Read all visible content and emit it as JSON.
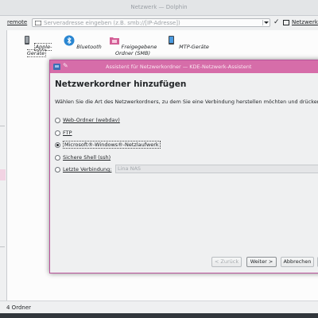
{
  "main_window": {
    "title": "Netzwerk — Dolphin",
    "toolbar": {
      "remote_label": "remote",
      "location_placeholder": "Serveradresse eingeben (z.B. smb://[IP-Adresse])",
      "confirm_glyph": "✓",
      "breadcrumb": "Netzwerk"
    },
    "places": [
      {
        "label": "Apple-Geräte",
        "icon": "apple-device-icon"
      },
      {
        "label": "Bluetooth",
        "icon": "bluetooth-icon"
      },
      {
        "label": "Freigegebene Ordner (SMB)",
        "icon": "smb-folder-icon"
      },
      {
        "label": "MTP-Geräte",
        "icon": "mtp-device-icon"
      }
    ],
    "status_text": "4 Ordner"
  },
  "wizard": {
    "title": "Assistent für Netzwerkordner — KDE-Netzwerk-Assistent",
    "heading": "Netzwerkordner hinzufügen",
    "description": "Wählen Sie die Art des Netzwerkordners, zu dem Sie eine Verbindung herstellen möchten und drücken",
    "options": [
      {
        "label": "Web-Ordner (webdav)",
        "checked": false
      },
      {
        "label": "FTP",
        "checked": false
      },
      {
        "label": "Microsoft®-Windows®-Netzlaufwerk",
        "checked": true
      },
      {
        "label": "Sichere Shell (ssh)",
        "checked": false
      },
      {
        "label": "Letzte Verbindung:",
        "checked": false
      }
    ],
    "recent_connection_value": "Lina NAS",
    "buttons": {
      "back": "< Zurück",
      "next": "Weiter >",
      "cancel": "Abbrechen"
    },
    "colors": {
      "titlebar": "#d66da9",
      "border": "#b8539a"
    }
  }
}
